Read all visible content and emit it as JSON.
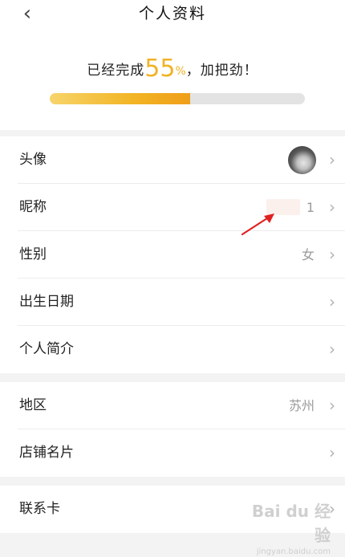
{
  "header": {
    "title": "个人资料",
    "back_glyph": "‹"
  },
  "progress": {
    "prefix": "已经完成",
    "percent_number": "55",
    "percent_sign": "%",
    "suffix": "，加把劲！",
    "fraction": 0.55,
    "fill_color": "#f2b424",
    "track_color": "#e3e3e3"
  },
  "profile_items": [
    {
      "label": "头像",
      "value": ""
    },
    {
      "label": "昵称",
      "value": "1"
    },
    {
      "label": "性别",
      "value": "女"
    },
    {
      "label": "出生日期",
      "value": ""
    },
    {
      "label": "个人简介",
      "value": ""
    }
  ],
  "location_items": [
    {
      "label": "地区",
      "value": "苏州"
    },
    {
      "label": "店铺名片",
      "value": ""
    }
  ],
  "contact_items": [
    {
      "label": "联系卡",
      "value": ""
    }
  ],
  "chevron_glyph": "›",
  "watermark": {
    "text": "Bai du 经验",
    "sub": "jingyan.baidu.com"
  },
  "colors": {
    "accent": "#f0b326",
    "annotation": "#e02020"
  }
}
